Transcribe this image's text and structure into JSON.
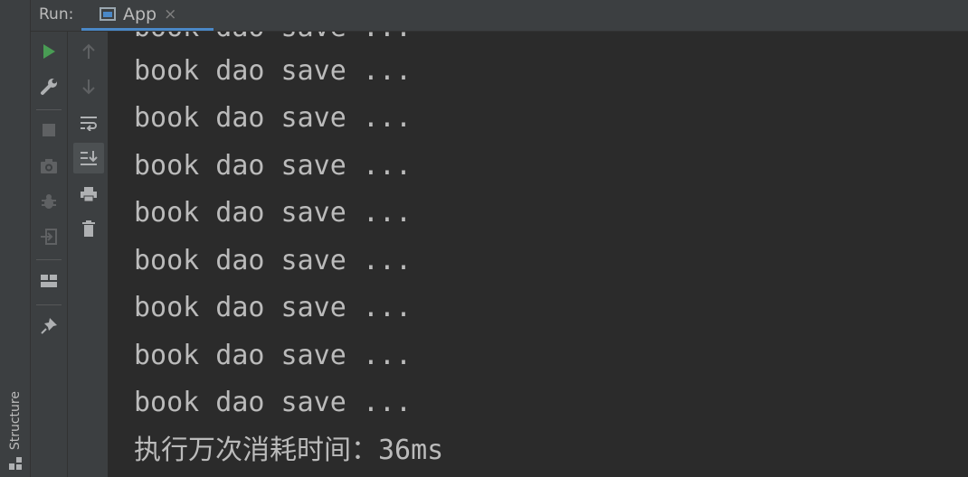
{
  "header": {
    "run_label": "Run:",
    "tab": {
      "label": "App",
      "close": "×"
    }
  },
  "sidebar": {
    "structure_label": "Structure"
  },
  "toolbar": {
    "left": [
      "run-icon",
      "wrench-icon",
      "stop-icon",
      "camera-icon",
      "debug-bug-icon",
      "exit-icon",
      "layout-icon",
      "pin-icon"
    ],
    "right": [
      "arrow-up-icon",
      "arrow-down-icon",
      "soft-wrap-icon",
      "scroll-to-end-icon",
      "print-icon",
      "trash-icon"
    ]
  },
  "console": {
    "lines": [
      "book dao save ...",
      "book dao save ...",
      "book dao save ...",
      "book dao save ...",
      "book dao save ...",
      "book dao save ...",
      "book dao save ...",
      "book dao save ...",
      "book dao save ..."
    ],
    "result": "执行万次消耗时间：36ms"
  },
  "colors": {
    "run_green": "#499c54",
    "accent_blue": "#4a88c7",
    "console_bg": "#2b2b2b",
    "panel_bg": "#3c3f41",
    "text": "#bbbbbb"
  }
}
